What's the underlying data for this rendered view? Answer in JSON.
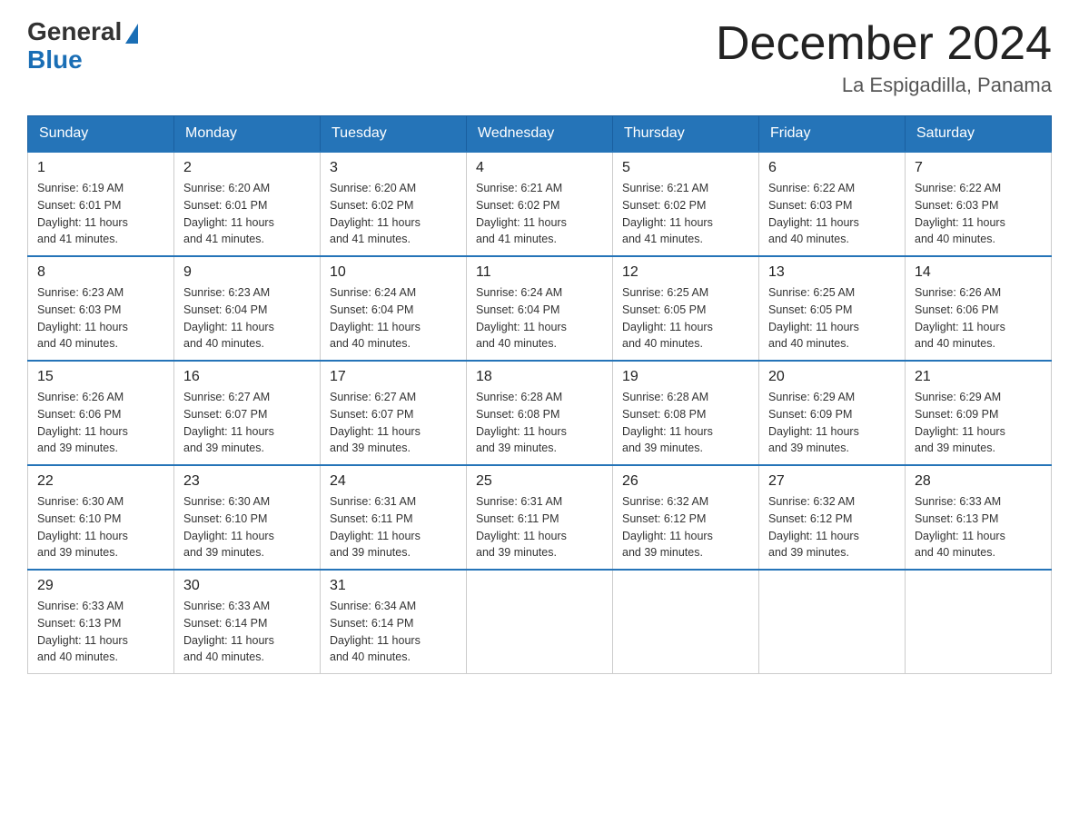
{
  "header": {
    "logo_general": "General",
    "logo_blue": "Blue",
    "month_title": "December 2024",
    "location": "La Espigadilla, Panama"
  },
  "weekdays": [
    "Sunday",
    "Monday",
    "Tuesday",
    "Wednesday",
    "Thursday",
    "Friday",
    "Saturday"
  ],
  "weeks": [
    [
      {
        "day": "1",
        "sunrise": "6:19 AM",
        "sunset": "6:01 PM",
        "daylight": "11 hours and 41 minutes."
      },
      {
        "day": "2",
        "sunrise": "6:20 AM",
        "sunset": "6:01 PM",
        "daylight": "11 hours and 41 minutes."
      },
      {
        "day": "3",
        "sunrise": "6:20 AM",
        "sunset": "6:02 PM",
        "daylight": "11 hours and 41 minutes."
      },
      {
        "day": "4",
        "sunrise": "6:21 AM",
        "sunset": "6:02 PM",
        "daylight": "11 hours and 41 minutes."
      },
      {
        "day": "5",
        "sunrise": "6:21 AM",
        "sunset": "6:02 PM",
        "daylight": "11 hours and 41 minutes."
      },
      {
        "day": "6",
        "sunrise": "6:22 AM",
        "sunset": "6:03 PM",
        "daylight": "11 hours and 40 minutes."
      },
      {
        "day": "7",
        "sunrise": "6:22 AM",
        "sunset": "6:03 PM",
        "daylight": "11 hours and 40 minutes."
      }
    ],
    [
      {
        "day": "8",
        "sunrise": "6:23 AM",
        "sunset": "6:03 PM",
        "daylight": "11 hours and 40 minutes."
      },
      {
        "day": "9",
        "sunrise": "6:23 AM",
        "sunset": "6:04 PM",
        "daylight": "11 hours and 40 minutes."
      },
      {
        "day": "10",
        "sunrise": "6:24 AM",
        "sunset": "6:04 PM",
        "daylight": "11 hours and 40 minutes."
      },
      {
        "day": "11",
        "sunrise": "6:24 AM",
        "sunset": "6:04 PM",
        "daylight": "11 hours and 40 minutes."
      },
      {
        "day": "12",
        "sunrise": "6:25 AM",
        "sunset": "6:05 PM",
        "daylight": "11 hours and 40 minutes."
      },
      {
        "day": "13",
        "sunrise": "6:25 AM",
        "sunset": "6:05 PM",
        "daylight": "11 hours and 40 minutes."
      },
      {
        "day": "14",
        "sunrise": "6:26 AM",
        "sunset": "6:06 PM",
        "daylight": "11 hours and 40 minutes."
      }
    ],
    [
      {
        "day": "15",
        "sunrise": "6:26 AM",
        "sunset": "6:06 PM",
        "daylight": "11 hours and 39 minutes."
      },
      {
        "day": "16",
        "sunrise": "6:27 AM",
        "sunset": "6:07 PM",
        "daylight": "11 hours and 39 minutes."
      },
      {
        "day": "17",
        "sunrise": "6:27 AM",
        "sunset": "6:07 PM",
        "daylight": "11 hours and 39 minutes."
      },
      {
        "day": "18",
        "sunrise": "6:28 AM",
        "sunset": "6:08 PM",
        "daylight": "11 hours and 39 minutes."
      },
      {
        "day": "19",
        "sunrise": "6:28 AM",
        "sunset": "6:08 PM",
        "daylight": "11 hours and 39 minutes."
      },
      {
        "day": "20",
        "sunrise": "6:29 AM",
        "sunset": "6:09 PM",
        "daylight": "11 hours and 39 minutes."
      },
      {
        "day": "21",
        "sunrise": "6:29 AM",
        "sunset": "6:09 PM",
        "daylight": "11 hours and 39 minutes."
      }
    ],
    [
      {
        "day": "22",
        "sunrise": "6:30 AM",
        "sunset": "6:10 PM",
        "daylight": "11 hours and 39 minutes."
      },
      {
        "day": "23",
        "sunrise": "6:30 AM",
        "sunset": "6:10 PM",
        "daylight": "11 hours and 39 minutes."
      },
      {
        "day": "24",
        "sunrise": "6:31 AM",
        "sunset": "6:11 PM",
        "daylight": "11 hours and 39 minutes."
      },
      {
        "day": "25",
        "sunrise": "6:31 AM",
        "sunset": "6:11 PM",
        "daylight": "11 hours and 39 minutes."
      },
      {
        "day": "26",
        "sunrise": "6:32 AM",
        "sunset": "6:12 PM",
        "daylight": "11 hours and 39 minutes."
      },
      {
        "day": "27",
        "sunrise": "6:32 AM",
        "sunset": "6:12 PM",
        "daylight": "11 hours and 39 minutes."
      },
      {
        "day": "28",
        "sunrise": "6:33 AM",
        "sunset": "6:13 PM",
        "daylight": "11 hours and 40 minutes."
      }
    ],
    [
      {
        "day": "29",
        "sunrise": "6:33 AM",
        "sunset": "6:13 PM",
        "daylight": "11 hours and 40 minutes."
      },
      {
        "day": "30",
        "sunrise": "6:33 AM",
        "sunset": "6:14 PM",
        "daylight": "11 hours and 40 minutes."
      },
      {
        "day": "31",
        "sunrise": "6:34 AM",
        "sunset": "6:14 PM",
        "daylight": "11 hours and 40 minutes."
      },
      null,
      null,
      null,
      null
    ]
  ],
  "labels": {
    "sunrise": "Sunrise:",
    "sunset": "Sunset:",
    "daylight": "Daylight:"
  }
}
